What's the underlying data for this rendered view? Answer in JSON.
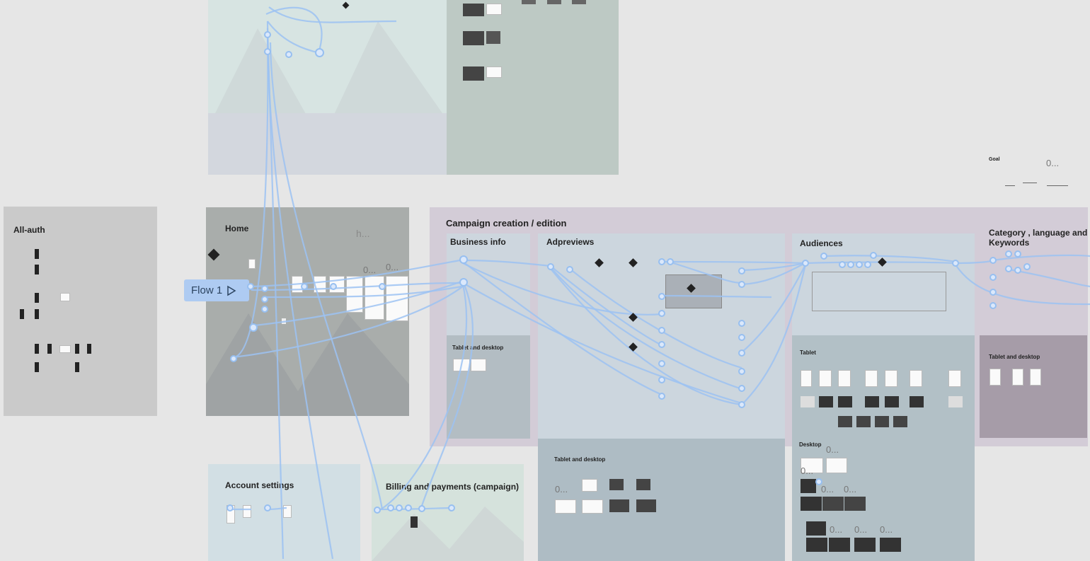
{
  "sections": {
    "all_auth": "All-auth",
    "home": "Home",
    "campaign": "Campaign creation / edition",
    "business_info": "Business info",
    "adpreviews": "Adpreviews",
    "audiences": "Audiences",
    "category": "Category , language and",
    "category2": "Keywords",
    "account_settings": "Account settings",
    "billing": "Billing and payments (campaign)",
    "tablet_desktop": "Tablet and desktop",
    "tablet": "Tablet",
    "desktop": "Desktop",
    "goal": "Goal"
  },
  "flow": {
    "label": "Flow 1"
  },
  "placeholders": {
    "h": "h...",
    "zero": "0..."
  },
  "colors": {
    "canvas": "#e6e6e6",
    "connector": "#9cc2f2",
    "flow_tag": "#aecbf2"
  },
  "icons": [
    "play-triangle-icon",
    "connector-node-icon",
    "diamond-decision-icon"
  ]
}
